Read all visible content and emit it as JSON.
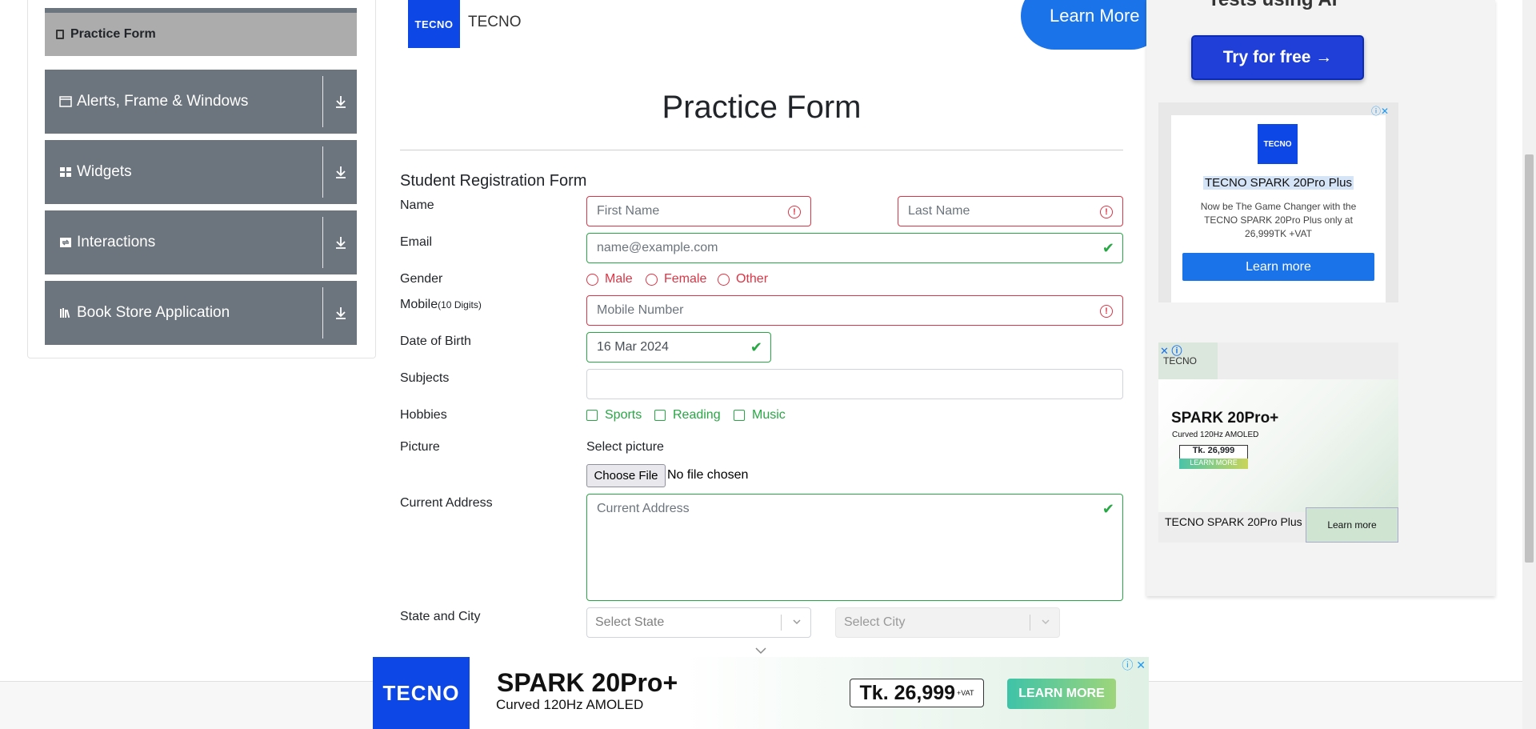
{
  "sidebar": {
    "active_item": "Practice Form",
    "groups": [
      {
        "label": "Alerts, Frame & Windows",
        "icon": "window-icon"
      },
      {
        "label": "Widgets",
        "icon": "widgets-icon"
      },
      {
        "label": "Interactions",
        "icon": "interactions-icon"
      },
      {
        "label": "Book Store Application",
        "icon": "books-icon"
      }
    ]
  },
  "top_ad": {
    "logo": "TECNO",
    "brand": "TECNO",
    "button": "Learn More"
  },
  "page_title": "Practice Form",
  "form": {
    "heading": "Student Registration Form",
    "labels": {
      "name": "Name",
      "email": "Email",
      "gender": "Gender",
      "mobile": "Mobile",
      "mobile_hint": "(10 Digits)",
      "dob": "Date of Birth",
      "subjects": "Subjects",
      "hobbies": "Hobbies",
      "picture": "Picture",
      "address": "Current Address",
      "state_city": "State and City"
    },
    "first_name_placeholder": "First Name",
    "last_name_placeholder": "Last Name",
    "email_placeholder": "name@example.com",
    "genders": [
      "Male",
      "Female",
      "Other"
    ],
    "mobile_placeholder": "Mobile Number",
    "dob_value": "16 Mar 2024",
    "hobbies": [
      "Sports",
      "Reading",
      "Music"
    ],
    "picture_label": "Select picture",
    "file_button": "Choose File",
    "file_status": "No file chosen",
    "address_placeholder": "Current Address",
    "state_placeholder": "Select State",
    "city_placeholder": "Select City"
  },
  "right_ads": {
    "top_cut_text": "Tests using AI",
    "try_button": "Try for free →",
    "ad1": {
      "logo": "TECNO",
      "title": "TECNO SPARK 20Pro Plus",
      "description": "Now be The Game Changer with the TECNO SPARK 20Pro Plus only at 26,999TK +VAT",
      "button": "Learn more"
    },
    "ad2": {
      "brand": "TECNO",
      "model": "SPARK 20Pro+",
      "subtitle": "Curved 120Hz AMOLED",
      "price": "Tk. 26,999",
      "learn_more_small": "LEARN MORE",
      "footer_title": "TECNO SPARK 20Pro Plus",
      "footer_button": "Learn more"
    }
  },
  "bottom_banner": {
    "logo": "TECNO",
    "model": "SPARK 20Pro+",
    "subtitle": "Curved 120Hz AMOLED",
    "price": "Tk. 26,999",
    "price_suffix": "+VAT",
    "button": "LEARN MORE"
  },
  "colors": {
    "sidebar_group": "#6c757d",
    "active_item": "#acacac",
    "invalid": "#dc3545",
    "valid": "#28a745",
    "brand_blue": "#0d47e6",
    "link_blue": "#1a73e8"
  }
}
